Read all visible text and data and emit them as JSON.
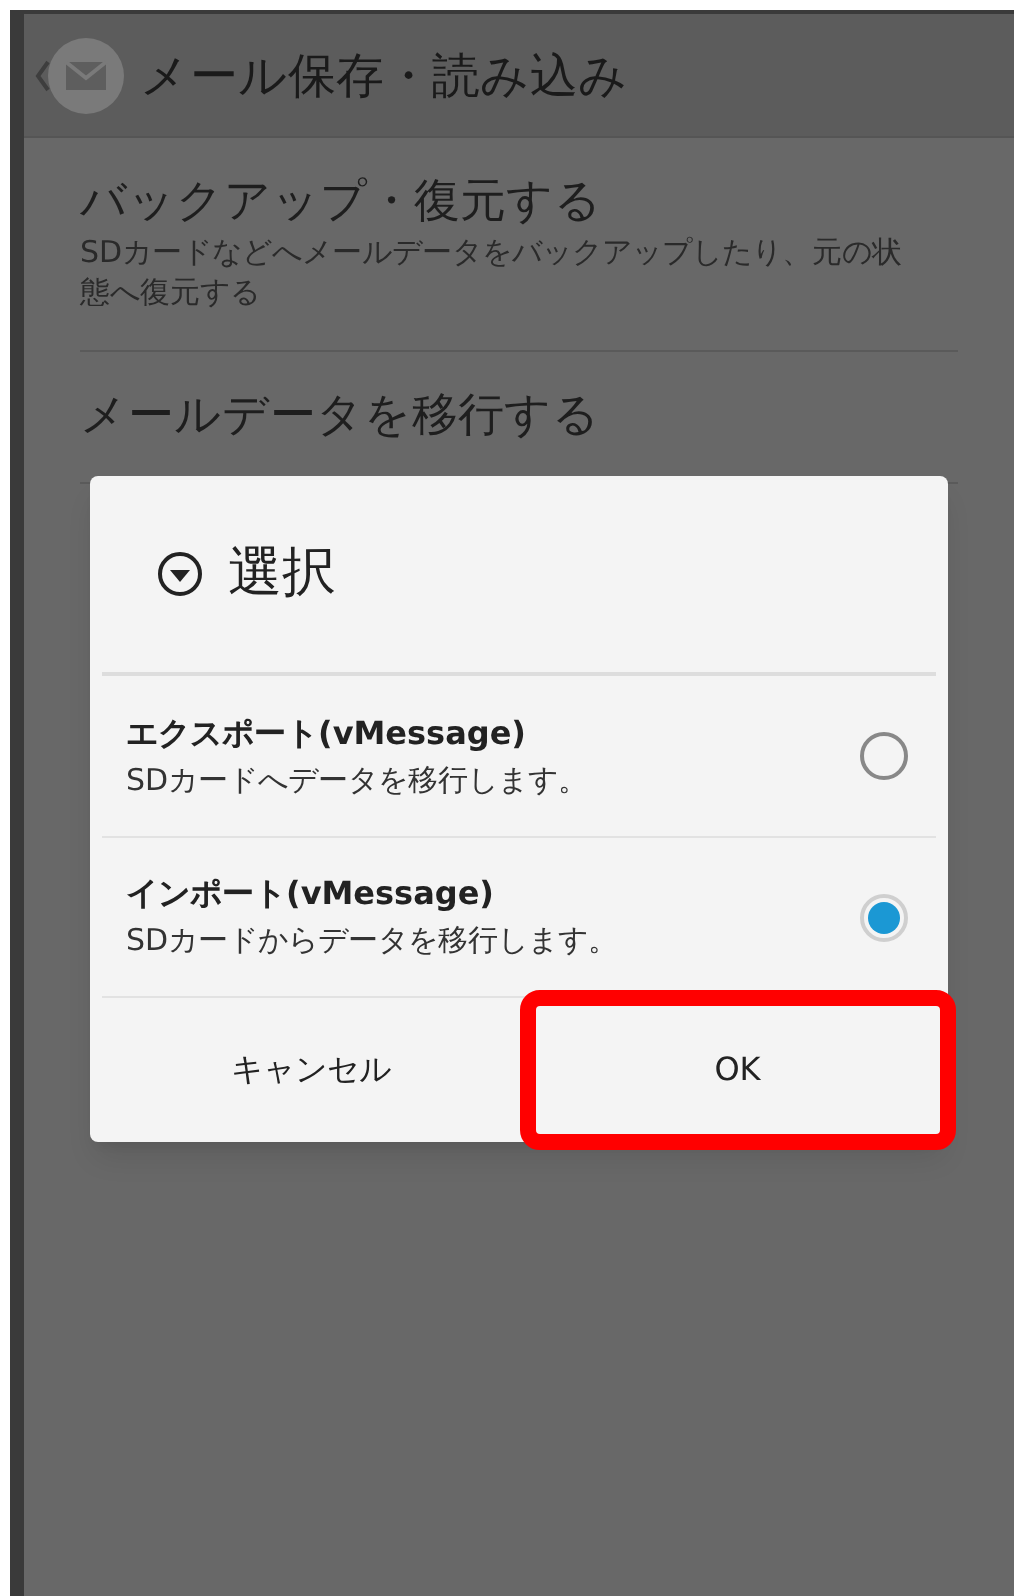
{
  "header": {
    "title": "メール保存・読み込み"
  },
  "settings": [
    {
      "title": "バックアップ・復元する",
      "description": "SDカードなどへメールデータをバックアップしたり、元の状態へ復元する"
    },
    {
      "title": "メールデータを移行する"
    }
  ],
  "dialog": {
    "title": "選択",
    "options": [
      {
        "label": "エクスポート(vMessage)",
        "description": "SDカードへデータを移行します。",
        "selected": false
      },
      {
        "label": "インポート(vMessage)",
        "description": "SDカードからデータを移行します。",
        "selected": true
      }
    ],
    "buttons": [
      {
        "label": "キャンセル",
        "highlighted": false
      },
      {
        "label": "OK",
        "highlighted": true
      }
    ]
  }
}
